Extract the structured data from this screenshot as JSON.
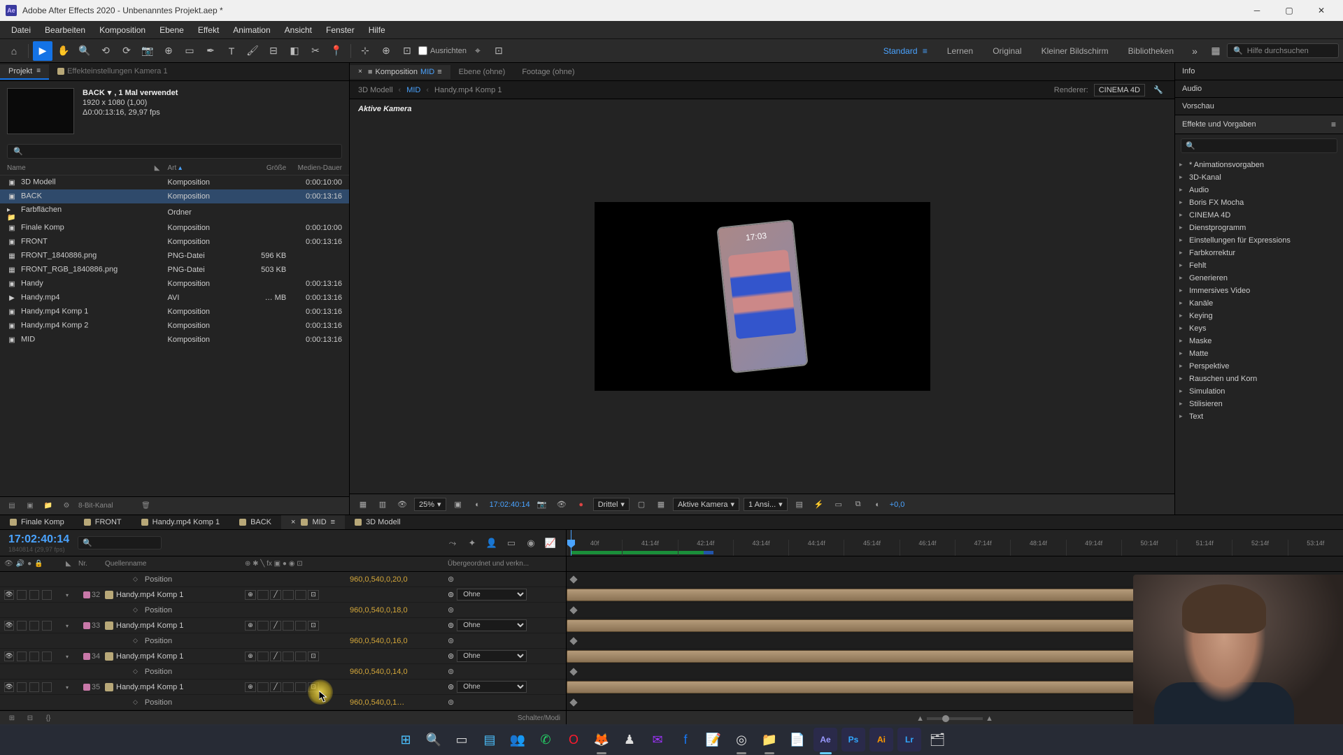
{
  "window": {
    "title": "Adobe After Effects 2020 - Unbenanntes Projekt.aep *",
    "app_icon": "Ae"
  },
  "menu": [
    "Datei",
    "Bearbeiten",
    "Komposition",
    "Ebene",
    "Effekt",
    "Animation",
    "Ansicht",
    "Fenster",
    "Hilfe"
  ],
  "toolbar": {
    "align_label": "Ausrichten",
    "workspaces": [
      "Standard",
      "Lernen",
      "Original",
      "Kleiner Bildschirm",
      "Bibliotheken"
    ],
    "search_placeholder": "Hilfe durchsuchen"
  },
  "project": {
    "tab": "Projekt",
    "fx_tab": "Effekteinstellungen  Kamera 1",
    "selected_name": "BACK",
    "usage": ", 1 Mal verwendet",
    "res": "1920 x 1080 (1,00)",
    "dur_fps": "Δ0:00:13:16, 29,97 fps",
    "cols": {
      "name": "Name",
      "label": "",
      "type": "Art",
      "size": "Größe",
      "dur": "Medien-Dauer"
    },
    "items": [
      {
        "name": "3D Modell",
        "type": "Komposition",
        "size": "",
        "dur": "0:00:10:00",
        "label": "swatch-sand",
        "icon": "▣"
      },
      {
        "name": "BACK",
        "type": "Komposition",
        "size": "",
        "dur": "0:00:13:16",
        "label": "swatch-sand",
        "icon": "▣",
        "selected": true
      },
      {
        "name": "Farbflächen",
        "type": "Ordner",
        "size": "",
        "dur": "",
        "label": "swatch-yellow",
        "icon": "▸📁"
      },
      {
        "name": "Finale Komp",
        "type": "Komposition",
        "size": "",
        "dur": "0:00:10:00",
        "label": "swatch-sand",
        "icon": "▣"
      },
      {
        "name": "FRONT",
        "type": "Komposition",
        "size": "",
        "dur": "0:00:13:16",
        "label": "swatch-sand",
        "icon": "▣"
      },
      {
        "name": "FRONT_1840886.png",
        "type": "PNG-Datei",
        "size": "596 KB",
        "dur": "",
        "label": "swatch-teal",
        "icon": "▦"
      },
      {
        "name": "FRONT_RGB_1840886.png",
        "type": "PNG-Datei",
        "size": "503 KB",
        "dur": "",
        "label": "swatch-teal",
        "icon": "▦"
      },
      {
        "name": "Handy",
        "type": "Komposition",
        "size": "",
        "dur": "0:00:13:16",
        "label": "swatch-sand",
        "icon": "▣"
      },
      {
        "name": "Handy.mp4",
        "type": "AVI",
        "size": "… MB",
        "dur": "0:00:13:16",
        "label": "swatch-orange",
        "icon": "▶"
      },
      {
        "name": "Handy.mp4 Komp 1",
        "type": "Komposition",
        "size": "",
        "dur": "0:00:13:16",
        "label": "swatch-sand",
        "icon": "▣"
      },
      {
        "name": "Handy.mp4 Komp 2",
        "type": "Komposition",
        "size": "",
        "dur": "0:00:13:16",
        "label": "swatch-sand",
        "icon": "▣"
      },
      {
        "name": "MID",
        "type": "Komposition",
        "size": "",
        "dur": "0:00:13:16",
        "label": "swatch-sand",
        "icon": "▣"
      }
    ],
    "footer_depth": "8-Bit-Kanal"
  },
  "comp": {
    "tabs": [
      {
        "label": "Komposition MID",
        "active": true,
        "close": true
      },
      {
        "label": "Ebene (ohne)"
      },
      {
        "label": "Footage (ohne)"
      }
    ],
    "breadcrumb": [
      "3D Modell",
      "MID",
      "Handy.mp4 Komp 1"
    ],
    "renderer_label": "Renderer:",
    "renderer": "CINEMA 4D",
    "viewer_label": "Aktive Kamera",
    "ctrl": {
      "zoom": "25%",
      "timecode": "17:02:40:14",
      "res": "Drittel",
      "view": "Aktive Kamera",
      "views": "1 Ansi...",
      "exp": "+0,0"
    }
  },
  "right": {
    "panels": [
      "Info",
      "Audio",
      "Vorschau"
    ],
    "effects_title": "Effekte und Vorgaben",
    "effects": [
      "* Animationsvorgaben",
      "3D-Kanal",
      "Audio",
      "Boris FX Mocha",
      "CINEMA 4D",
      "Dienstprogramm",
      "Einstellungen für Expressions",
      "Farbkorrektur",
      "Fehlt",
      "Generieren",
      "Immersives Video",
      "Kanäle",
      "Keying",
      "Keys",
      "Maske",
      "Matte",
      "Perspektive",
      "Rauschen und Korn",
      "Simulation",
      "Stilisieren",
      "Text"
    ]
  },
  "timeline": {
    "tabs": [
      {
        "label": "Finale Komp",
        "color": "swatch-sand"
      },
      {
        "label": "FRONT",
        "color": "swatch-sand"
      },
      {
        "label": "Handy.mp4 Komp 1",
        "color": "swatch-sand"
      },
      {
        "label": "BACK",
        "color": "swatch-sand"
      },
      {
        "label": "MID",
        "color": "swatch-sand",
        "active": true,
        "close": true
      },
      {
        "label": "3D Modell",
        "color": "swatch-sand"
      }
    ],
    "time": "17:02:40:14",
    "sub": "1840814 (29,97 fps)",
    "cols": {
      "nr": "Nr.",
      "name": "Quellenname",
      "parent": "Übergeordnet und verkn..."
    },
    "parent_none": "Ohne",
    "ticks": [
      "40f",
      "41:14f",
      "42:14f",
      "43:14f",
      "44:14f",
      "45:14f",
      "46:14f",
      "47:14f",
      "48:14f",
      "49:14f",
      "50:14f",
      "51:14f",
      "52:14f",
      "53:14f"
    ],
    "layers": [
      {
        "prop": true,
        "propname": "Position",
        "val": "960,0,540,0,20,0"
      },
      {
        "nr": "32",
        "name": "Handy.mp4 Komp 1",
        "color": "swatch-pink"
      },
      {
        "prop": true,
        "propname": "Position",
        "val": "960,0,540,0,18,0"
      },
      {
        "nr": "33",
        "name": "Handy.mp4 Komp 1",
        "color": "swatch-pink"
      },
      {
        "prop": true,
        "propname": "Position",
        "val": "960,0,540,0,16,0"
      },
      {
        "nr": "34",
        "name": "Handy.mp4 Komp 1",
        "color": "swatch-pink"
      },
      {
        "prop": true,
        "propname": "Position",
        "val": "960,0,540,0,14,0"
      },
      {
        "nr": "35",
        "name": "Handy.mp4 Komp 1",
        "color": "swatch-pink"
      },
      {
        "prop": true,
        "propname": "Position",
        "val": "960,0,540,0,1…"
      }
    ],
    "footer": "Schalter/Modi"
  },
  "taskbar": {
    "icons": [
      {
        "name": "start",
        "glyph": "⊞",
        "color": "#4cc2ff"
      },
      {
        "name": "search",
        "glyph": "🔍"
      },
      {
        "name": "taskview",
        "glyph": "▭"
      },
      {
        "name": "widgets",
        "glyph": "▤",
        "color": "#4cc2ff"
      },
      {
        "name": "teams",
        "glyph": "👥",
        "color": "#7b83eb"
      },
      {
        "name": "whatsapp",
        "glyph": "✆",
        "color": "#25d366"
      },
      {
        "name": "opera",
        "glyph": "O",
        "color": "#ff1b2d"
      },
      {
        "name": "firefox",
        "glyph": "🦊"
      },
      {
        "name": "app1",
        "glyph": "♟"
      },
      {
        "name": "messenger",
        "glyph": "✉",
        "color": "#a033ff"
      },
      {
        "name": "facebook",
        "glyph": "f",
        "color": "#1877f2"
      },
      {
        "name": "notes",
        "glyph": "📝"
      },
      {
        "name": "obs",
        "glyph": "◎"
      },
      {
        "name": "explorer",
        "glyph": "📁"
      },
      {
        "name": "notepad",
        "glyph": "📄"
      },
      {
        "name": "ae",
        "glyph": "Ae",
        "color": "#9999ff",
        "active": true
      },
      {
        "name": "ps",
        "glyph": "Ps",
        "color": "#31a8ff"
      },
      {
        "name": "ai",
        "glyph": "Ai",
        "color": "#ff9a00"
      },
      {
        "name": "lr",
        "glyph": "Lr",
        "color": "#31a8ff"
      },
      {
        "name": "app2",
        "glyph": "🗂"
      }
    ]
  }
}
